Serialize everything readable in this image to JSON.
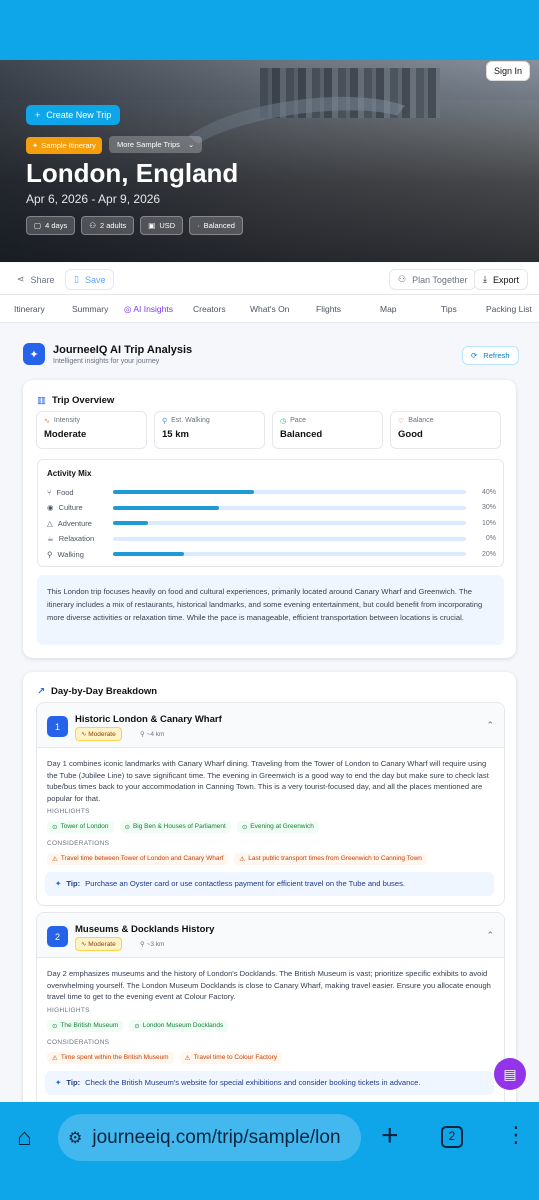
{
  "header": {
    "sign_in": "Sign In",
    "create_trip": "Create New Trip",
    "sample_badge": "Sample Itinerary",
    "more_trips": "More Sample Trips",
    "title": "London, England",
    "dates": "Apr 6, 2026 - Apr 9, 2026",
    "chips": [
      "4 days",
      "2 adults",
      "USD",
      "Balanced"
    ]
  },
  "actions": {
    "share": "Share",
    "save": "Save",
    "plan_together": "Plan Together",
    "export": "Export"
  },
  "tabs": [
    "Itinerary",
    "Summary",
    "AI Insights",
    "Creators",
    "What's On",
    "Flights",
    "Map",
    "Tips",
    "Packing List"
  ],
  "ai": {
    "title": "JourneeIQ AI Trip Analysis",
    "subtitle": "Intelligent insights for your journey",
    "refresh": "Refresh"
  },
  "overview": {
    "title": "Trip Overview",
    "stats": [
      {
        "label": "Intensity",
        "value": "Moderate"
      },
      {
        "label": "Est. Walking",
        "value": "15 km"
      },
      {
        "label": "Pace",
        "value": "Balanced"
      },
      {
        "label": "Balance",
        "value": "Good"
      }
    ],
    "mix_title": "Activity Mix",
    "mix": [
      {
        "name": "Food",
        "pct": 40,
        "pct_label": "40%"
      },
      {
        "name": "Culture",
        "pct": 30,
        "pct_label": "30%"
      },
      {
        "name": "Adventure",
        "pct": 10,
        "pct_label": "10%"
      },
      {
        "name": "Relaxation",
        "pct": 0,
        "pct_label": "0%"
      },
      {
        "name": "Walking",
        "pct": 20,
        "pct_label": "20%"
      }
    ],
    "summary": "This London trip focuses heavily on food and cultural experiences, primarily located around Canary Wharf and Greenwich. The itinerary includes a mix of restaurants, historical landmarks, and some evening entertainment, but could benefit from incorporating more diverse activities or relaxation time. While the pace is manageable, efficient transportation between locations is crucial."
  },
  "breakdown": {
    "title": "Day-by-Day Breakdown",
    "highlights_label": "HIGHLIGHTS",
    "considerations_label": "CONSIDERATIONS",
    "tip_label": "Tip:",
    "days": [
      {
        "num": "1",
        "title": "Historic London & Canary Wharf",
        "intensity": "Moderate",
        "distance": "~4 km",
        "text": "Day 1 combines iconic landmarks with Canary Wharf dining. Traveling from the Tower of London to Canary Wharf will require using the Tube (Jubilee Line) to save significant time. The evening in Greenwich is a good way to end the day but make sure to check last tube/bus times back to your accommodation in Canning Town. This is a very tourist-focused day, and all the places mentioned are popular for that.",
        "highlights": [
          "Tower of London",
          "Big Ben & Houses of Parliament",
          "Evening at Greenwich"
        ],
        "considerations": [
          "Travel time between Tower of London and Canary Wharf",
          "Last public transport times from Greenwich to Canning Town"
        ],
        "tip": "Purchase an Oyster card or use contactless payment for efficient travel on the Tube and buses."
      },
      {
        "num": "2",
        "title": "Museums & Docklands History",
        "intensity": "Moderate",
        "distance": "~3 km",
        "text": "Day 2 emphasizes museums and the history of London's Docklands. The British Museum is vast; prioritize specific exhibits to avoid overwhelming yourself. The London Museum Docklands is close to Canary Wharf, making travel easier. Ensure you allocate enough travel time to get to the evening event at Colour Factory.",
        "highlights": [
          "The British Museum",
          "London Museum Docklands"
        ],
        "considerations": [
          "Time spent within the British Museum",
          "Travel time to Colour Factory"
        ],
        "tip": "Check the British Museum's website for special exhibitions and consider booking tickets in advance."
      }
    ]
  },
  "browser": {
    "url": "journeeiq.com/trip/sample/lon",
    "tab_count": "2"
  },
  "colors": {
    "brand": "#0ea5e9",
    "accent_purple": "#7c3aed",
    "day_badge": "#2563eb"
  }
}
